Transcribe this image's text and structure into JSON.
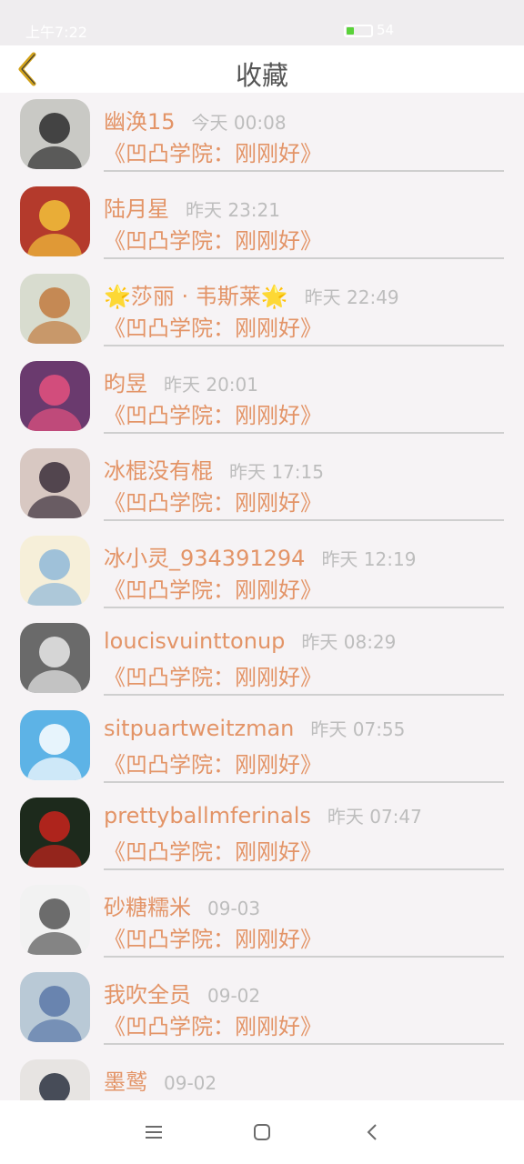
{
  "status": {
    "time": "上午7:22",
    "battery": "54"
  },
  "header": {
    "title": "收藏",
    "back_icon": "chevron-left-icon"
  },
  "colors": {
    "accent": "#e39467",
    "back_icon": "#d2a21a",
    "muted": "#bdbdbd",
    "background": "#f6f3f5"
  },
  "favorites": [
    {
      "name": "幽涣15",
      "time": "今天 00:08",
      "subtitle": "《凹凸学院：刚刚好》",
      "avatar_bg": "#c9c9c5",
      "avatar_fg": "#2b2b2b"
    },
    {
      "name": "陆月星",
      "time": "昨天 23:21",
      "subtitle": "《凹凸学院：刚刚好》",
      "avatar_bg": "#b43a2c",
      "avatar_fg": "#f2c23a"
    },
    {
      "name": "🌟莎丽 · 韦斯莱🌟",
      "time": "昨天 22:49",
      "subtitle": "《凹凸学院：刚刚好》",
      "avatar_bg": "#d8dccf",
      "avatar_fg": "#c27a3e"
    },
    {
      "name": "昀昱",
      "time": "昨天 20:01",
      "subtitle": "《凹凸学院：刚刚好》",
      "avatar_bg": "#6a3a6e",
      "avatar_fg": "#e4517f"
    },
    {
      "name": "冰棍没有棍",
      "time": "昨天 17:15",
      "subtitle": "《凹凸学院：刚刚好》",
      "avatar_bg": "#d8c8c2",
      "avatar_fg": "#3b2e3a"
    },
    {
      "name": "冰小灵_934391294",
      "time": "昨天 12:19",
      "subtitle": "《凹凸学院：刚刚好》",
      "avatar_bg": "#f6efd9",
      "avatar_fg": "#8fb8d8"
    },
    {
      "name": "loucisvuinttonup",
      "time": "昨天 08:29",
      "subtitle": "《凹凸学院：刚刚好》",
      "avatar_bg": "#6a6a6a",
      "avatar_fg": "#e9e9e9"
    },
    {
      "name": "sitpuartweitzman",
      "time": "昨天 07:55",
      "subtitle": "《凹凸学院：刚刚好》",
      "avatar_bg": "#5db3e6",
      "avatar_fg": "#ffffff"
    },
    {
      "name": "prettyballmferinals",
      "time": "昨天 07:47",
      "subtitle": "《凹凸学院：刚刚好》",
      "avatar_bg": "#1d2a1c",
      "avatar_fg": "#c8231c"
    },
    {
      "name": "砂糖糯米",
      "time": "09-03",
      "subtitle": "《凹凸学院：刚刚好》",
      "avatar_bg": "#f2f2f2",
      "avatar_fg": "#555555"
    },
    {
      "name": "我吹全员",
      "time": "09-02",
      "subtitle": "《凹凸学院：刚刚好》",
      "avatar_bg": "#b9c9d6",
      "avatar_fg": "#5a78a8"
    },
    {
      "name": "墨鹫",
      "time": "09-02",
      "subtitle": "",
      "avatar_bg": "#e7e4e2",
      "avatar_fg": "#2a3140"
    }
  ],
  "navbar": {
    "items": [
      "menu-icon",
      "home-square-icon",
      "back-chevron-icon"
    ]
  }
}
